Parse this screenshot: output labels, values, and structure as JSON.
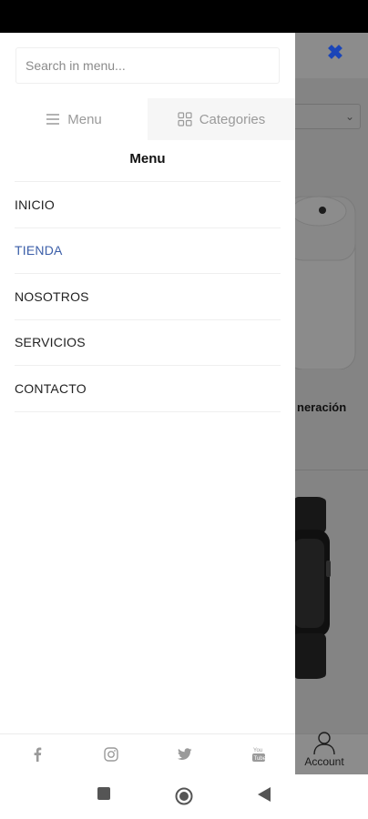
{
  "drawer": {
    "search_placeholder": "Search in menu...",
    "tabs": [
      {
        "label": "Menu",
        "icon": "hamburger-icon",
        "active": true
      },
      {
        "label": "Categories",
        "icon": "grid-icon",
        "active": false
      }
    ],
    "heading": "Menu",
    "items": [
      {
        "label": "INICIO",
        "active": false
      },
      {
        "label": "TIENDA",
        "active": true
      },
      {
        "label": "NOSOTROS",
        "active": false
      },
      {
        "label": "SERVICIOS",
        "active": false
      },
      {
        "label": "CONTACTO",
        "active": false
      }
    ],
    "social": [
      "facebook-icon",
      "instagram-icon",
      "twitter-icon",
      "youtube-icon"
    ]
  },
  "background": {
    "product_title_fragment": "neración",
    "account_label": "Account"
  },
  "close_icon": "close-icon",
  "colors": {
    "accent": "#1a45b8",
    "active_item": "#3b5ea8",
    "muted": "#9a9a9a"
  }
}
